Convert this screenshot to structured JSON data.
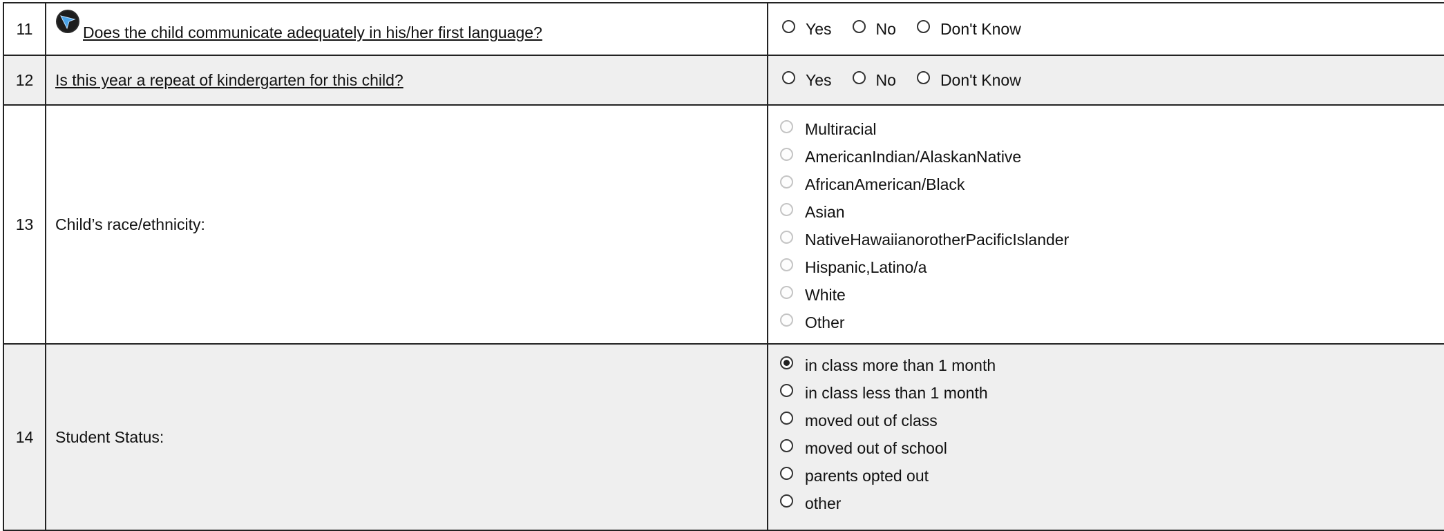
{
  "rows": [
    {
      "num": "11",
      "question": "Does the child communicate adequately in his/her first language?",
      "options": [
        "Yes",
        "No",
        "Don't Know"
      ]
    },
    {
      "num": "12",
      "question": "Is this year a repeat of kindergarten for this child?",
      "options": [
        "Yes",
        "No",
        "Don't Know"
      ]
    },
    {
      "num": "13",
      "question": "Child’s race/ethnicity:",
      "options": [
        "Multiracial",
        "AmericanIndian/AlaskanNative",
        "AfricanAmerican/Black",
        "Asian",
        "NativeHawaiianorotherPacificIslander",
        "Hispanic,Latino/a",
        "White",
        "Other"
      ]
    },
    {
      "num": "14",
      "question": "Student Status:",
      "options": [
        "in class more than 1 month",
        "in class less than 1 month",
        "moved out of class",
        "moved out of school",
        "parents opted out",
        "other"
      ],
      "selected": "in class more than 1 month"
    }
  ],
  "icons": {
    "navigate": "navigate-arrow-icon"
  }
}
